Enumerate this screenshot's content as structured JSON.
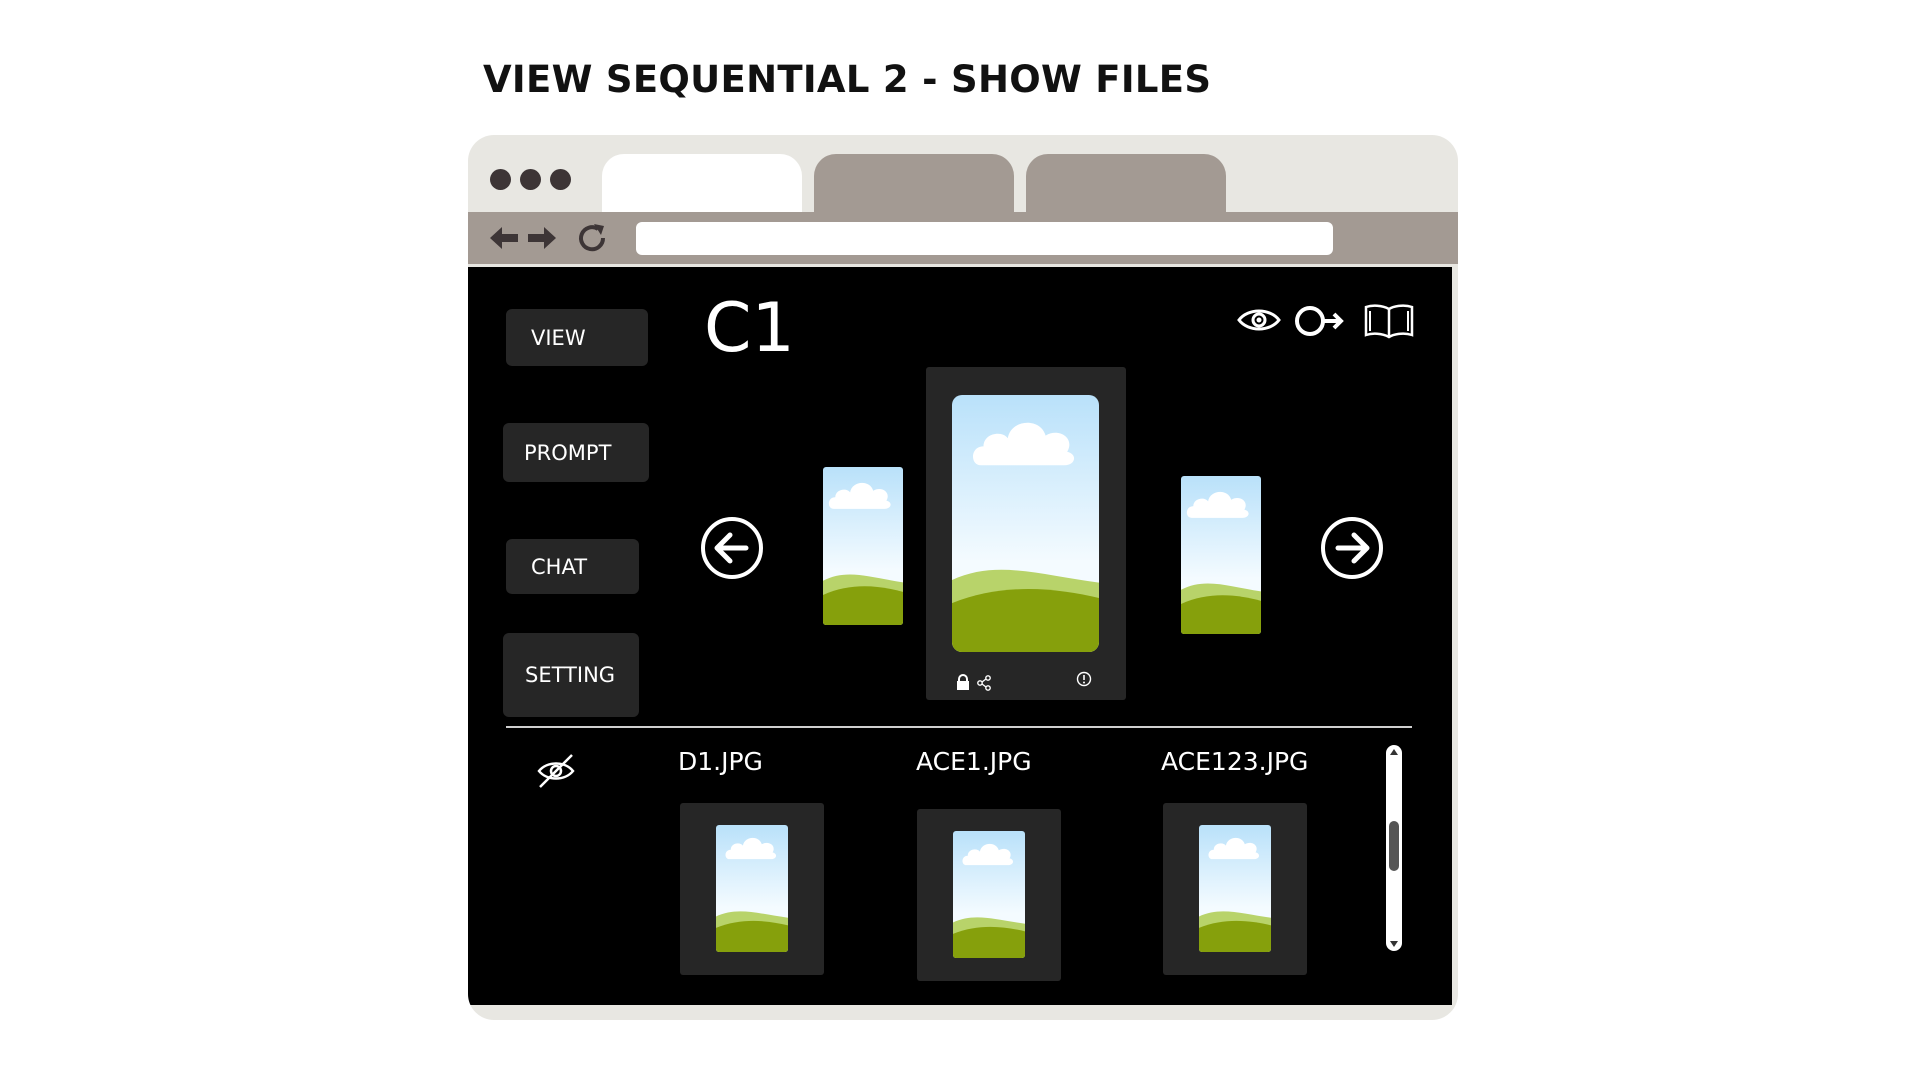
{
  "page_heading": "VIEW SEQUENTIAL 2 - SHOW FILES",
  "browser": {
    "window_dots": [
      "dot",
      "dot",
      "dot"
    ],
    "tabs": [
      "",
      "",
      ""
    ],
    "address_bar": "",
    "nav_icons": [
      "back-arrow-icon",
      "forward-arrow-icon",
      "reload-icon"
    ]
  },
  "sidebar": {
    "buttons": [
      {
        "label": "VIEW"
      },
      {
        "label": "PROMPT"
      },
      {
        "label": "CHAT"
      },
      {
        "label": "SETTING"
      }
    ]
  },
  "main": {
    "title": "C1",
    "header_icons": [
      "eye-icon",
      "login-key-icon",
      "open-book-icon"
    ],
    "carousel": {
      "prev_icon": "arrow-left-circle-icon",
      "next_icon": "arrow-right-circle-icon",
      "viewer_icons": [
        "lock-icon",
        "share-icon",
        "info-icon"
      ]
    }
  },
  "files": {
    "hide_icon": "eye-slash-icon",
    "items": [
      {
        "name": "D1.JPG"
      },
      {
        "name": "ACE1.JPG"
      },
      {
        "name": "ACE123.JPG"
      }
    ]
  },
  "colors": {
    "chrome_light": "#e8e7e2",
    "chrome_mid": "#a39a93",
    "content_bg": "#000000",
    "button_bg": "#262626",
    "sky_top": "#b9e1fa",
    "grass_light": "#b8d36a",
    "grass_dark": "#86a00c"
  }
}
